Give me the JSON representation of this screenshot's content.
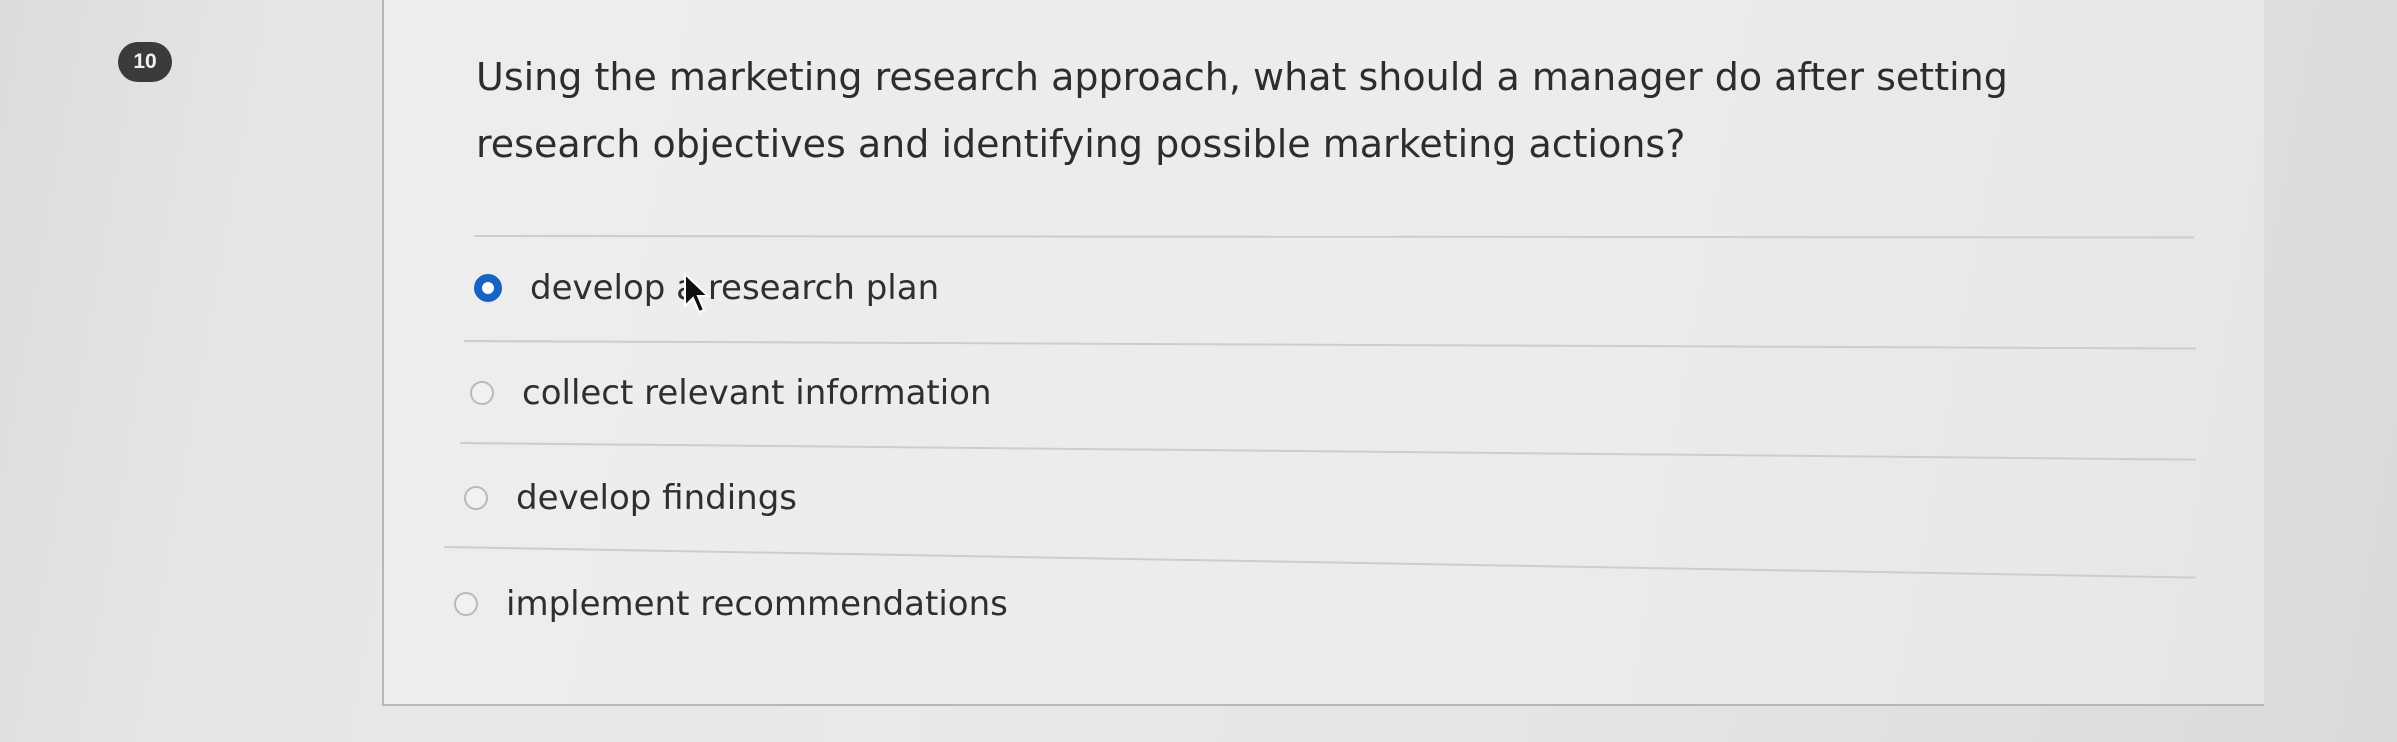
{
  "question": {
    "number": "10",
    "text": "Using the marketing research approach, what should a manager do after setting research objectives and identifying possible marketing actions?"
  },
  "options": [
    {
      "label": "develop a research plan",
      "selected": true
    },
    {
      "label": "collect relevant information",
      "selected": false
    },
    {
      "label": "develop findings",
      "selected": false
    },
    {
      "label": "implement recommendations",
      "selected": false
    }
  ],
  "colors": {
    "selected_radio": "#1762c4",
    "number_badge": "#3b3b3b"
  },
  "icons": {
    "cursor": "mouse-pointer-icon"
  }
}
